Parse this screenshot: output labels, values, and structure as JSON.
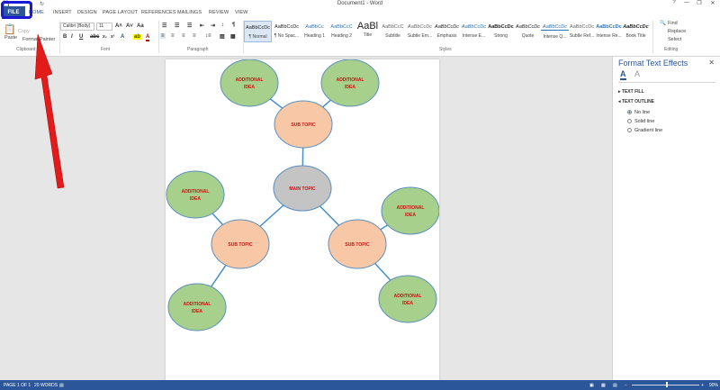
{
  "window": {
    "title": "Document1 - Word",
    "controls": [
      "?",
      "—",
      "❐",
      "✕"
    ]
  },
  "qat": {
    "save": "💾",
    "undo": "↶",
    "redo": "↻"
  },
  "ribbon_tabs": [
    "FILE",
    "HOME",
    "INSERT",
    "DESIGN",
    "PAGE LAYOUT",
    "REFERENCES",
    "MAILINGS",
    "REVIEW",
    "VIEW"
  ],
  "clipboard": {
    "paste": "Paste",
    "cut": "Cut",
    "copy": "Copy",
    "format_painter": "Format Painter",
    "label": "Clipboard"
  },
  "font": {
    "name": "Calibri (Body)",
    "size": "11",
    "label": "Font"
  },
  "paragraph": {
    "label": "Paragraph"
  },
  "styles": {
    "label": "Styles",
    "items": [
      {
        "sample": "AaBbCcDc",
        "name": "¶ Normal"
      },
      {
        "sample": "AaBbCcDc",
        "name": "¶ No Spac..."
      },
      {
        "sample": "AaBbCc",
        "name": "Heading 1"
      },
      {
        "sample": "AaBbCcC",
        "name": "Heading 2"
      },
      {
        "sample": "AaBl",
        "name": "Title"
      },
      {
        "sample": "AaBbCcC",
        "name": "Subtitle"
      },
      {
        "sample": "AaBbCcDc",
        "name": "Subtle Em..."
      },
      {
        "sample": "AaBbCcDc",
        "name": "Emphasis"
      },
      {
        "sample": "AaBbCcDc",
        "name": "Intense E..."
      },
      {
        "sample": "AaBbCcDc",
        "name": "Strong"
      },
      {
        "sample": "AaBbCcDc",
        "name": "Quote"
      },
      {
        "sample": "AaBbCcDc",
        "name": "Intense Q..."
      },
      {
        "sample": "AaBbCcDc",
        "name": "Subtle Ref..."
      },
      {
        "sample": "AaBbCcDc",
        "name": "Intense Re..."
      },
      {
        "sample": "AaBbCcDc",
        "name": "Book Title"
      }
    ]
  },
  "editing": {
    "find": "Find",
    "replace": "Replace",
    "select": "Select",
    "label": "Editing"
  },
  "mindmap": {
    "main": "MAIN TOPIC",
    "sub": [
      "SUB TOPIC",
      "SUB TOPIC",
      "SUB TOPIC"
    ],
    "idea": [
      "ADDITIONAL IDEA",
      "ADDITIONAL IDEA",
      "ADDITIONAL IDEA",
      "ADDITIONAL IDEA",
      "ADDITIONAL IDEA",
      "ADDITIONAL IDEA"
    ],
    "colors": {
      "main": "#c4c4c4",
      "sub": "#f8c8a6",
      "idea": "#a7d08c",
      "text": "#d01010",
      "line": "#4a90c8"
    }
  },
  "pane": {
    "title": "Format Text Effects",
    "close": "✕",
    "text_fill": "TEXT FILL",
    "text_outline": "TEXT OUTLINE",
    "options": [
      {
        "label": "No line",
        "selected": true
      },
      {
        "label": "Solid line",
        "selected": false
      },
      {
        "label": "Gradient line",
        "selected": false
      }
    ]
  },
  "status": {
    "page": "PAGE 1 OF 1",
    "words": "20 WORDS",
    "zoom": "90%"
  }
}
